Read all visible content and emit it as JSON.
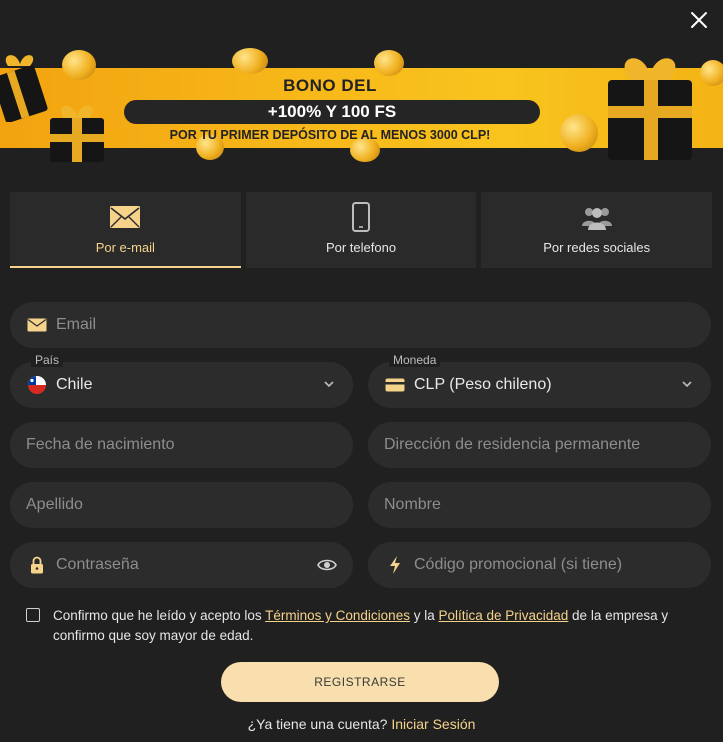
{
  "banner": {
    "title": "BONO DEL",
    "highlight": "+100% Y 100 FS",
    "subtitle": "POR TU PRIMER DEPÓSITO DE AL MENOS 3000 CLP!"
  },
  "tabs": [
    {
      "label": "Por e-mail",
      "icon": "envelope-icon",
      "active": true
    },
    {
      "label": "Por telefono",
      "icon": "phone-icon",
      "active": false
    },
    {
      "label": "Por redes sociales",
      "icon": "users-icon",
      "active": false
    }
  ],
  "form": {
    "email_placeholder": "Email",
    "country_label": "País",
    "country_value": "Chile",
    "currency_label": "Moneda",
    "currency_value": "CLP (Peso chileno)",
    "birthdate_placeholder": "Fecha de nacimiento",
    "address_placeholder": "Dirección de residencia permanente",
    "lastname_placeholder": "Apellido",
    "firstname_placeholder": "Nombre",
    "password_placeholder": "Contraseña",
    "promo_placeholder": "Código promocional (si tiene)"
  },
  "terms": {
    "prefix": "Confirmo que he leído y acepto los ",
    "terms_link": "Términos y Condiciones",
    "middle": " y la ",
    "privacy_link": "Política de Privacidad",
    "suffix": " de la empresa y confirmo que soy mayor de edad."
  },
  "register_label": "REGISTRARSE",
  "login": {
    "question": "¿Ya tiene una cuenta? ",
    "link": "Iniciar Sesión"
  },
  "colors": {
    "accent": "#f5d38a",
    "background": "#202020",
    "field": "#2c2c2c",
    "banner": "#f7b719"
  }
}
